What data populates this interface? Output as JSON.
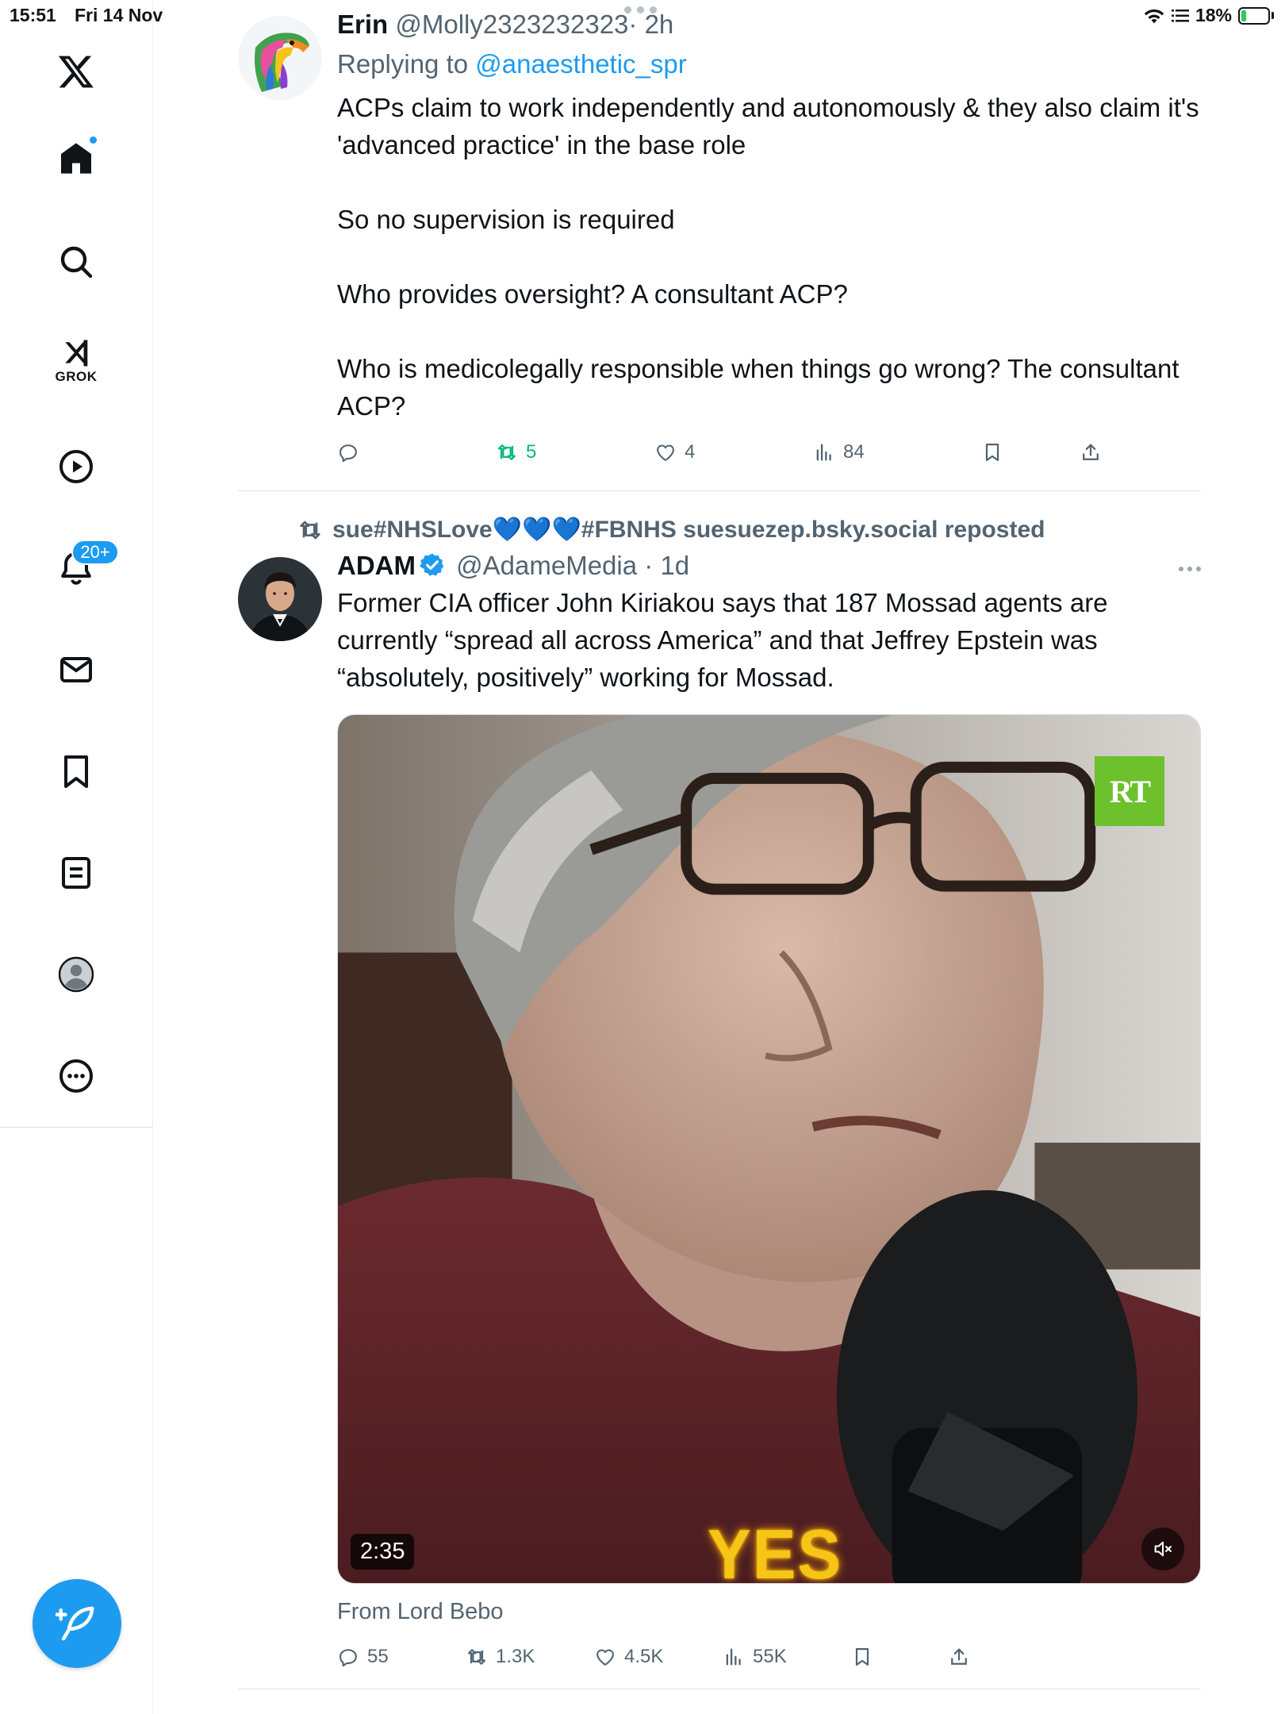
{
  "status_bar": {
    "time": "15:51",
    "date": "Fri 14 Nov",
    "battery": "18%",
    "battery_level": 0.18
  },
  "sidebar": {
    "logo": "x-logo-icon",
    "items": [
      {
        "name": "home",
        "icon": "home-icon"
      },
      {
        "name": "search",
        "icon": "search-icon"
      },
      {
        "name": "grok",
        "icon": "grok-icon",
        "label": "GROK"
      },
      {
        "name": "video",
        "icon": "play-circle-icon"
      },
      {
        "name": "notifications",
        "icon": "bell-icon",
        "badge": "20+"
      },
      {
        "name": "messages",
        "icon": "envelope-icon"
      },
      {
        "name": "bookmarks",
        "icon": "bookmark-icon"
      },
      {
        "name": "lists",
        "icon": "list-icon"
      },
      {
        "name": "profile",
        "icon": "profile-avatar-icon"
      },
      {
        "name": "more",
        "icon": "more-circle-icon"
      }
    ],
    "compose_icon": "compose-feather-icon"
  },
  "colors": {
    "accent": "#1d9bf0",
    "text": "#0f1419",
    "secondary": "#536471",
    "retweet_active": "#00ba7c"
  },
  "tweets": [
    {
      "name": "Erin",
      "handle": "@Molly2323232323",
      "time": "· 2h",
      "replying_prefix": "Replying to ",
      "replying_to": "@anaesthetic_spr",
      "text": "ACPs claim to work independently and autonomously & they also claim it's 'advanced practice' in the base role\n\nSo no supervision is required\n\nWho provides oversight? A consultant ACP?\n\nWho is medicolegally responsible when things go wrong? The consultant ACP?",
      "actions": {
        "replies": "",
        "retweets": "5",
        "likes": "4",
        "views": "84"
      }
    },
    {
      "repost_label": "sue#NHSLove💙💙💙#FBNHS suesuezep.bsky.social reposted",
      "name": "ADAM",
      "handle": "@AdameMedia",
      "time": "· 1d",
      "verified": true,
      "text": "Former CIA officer John Kiriakou says that 187 Mossad agents are currently “spread all across America” and that Jeffrey Epstein was “absolutely, positively” working for Mossad.",
      "media": {
        "duration": "2:35",
        "overlay_logo": "RT",
        "caption_word": "YES",
        "muted": true
      },
      "from_line": "From Lord Bebo",
      "actions": {
        "replies": "55",
        "retweets": "1.3K",
        "likes": "4.5K",
        "views": "55K"
      }
    }
  ]
}
